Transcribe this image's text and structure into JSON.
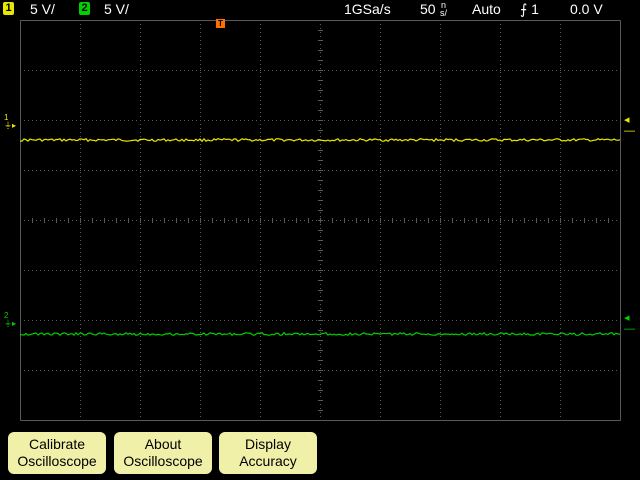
{
  "status": {
    "ch1_number": "1",
    "ch1_scale": "5 V/",
    "ch2_number": "2",
    "ch2_scale": "5 V/",
    "sample_rate": "1GSa/s",
    "timebase_value": "50",
    "timebase_unit_top": "n",
    "timebase_unit_bottom": "s/",
    "trigger_mode": "Auto",
    "trigger_source": "⨍ 1",
    "trigger_level": "0.0 V"
  },
  "markers": {
    "ch1_ground_label": "1",
    "ch2_ground_label": "2",
    "trigger_position_label": "T"
  },
  "softkeys": [
    {
      "line1": "Calibrate",
      "line2": "Oscilloscope"
    },
    {
      "line1": "About",
      "line2": "Oscilloscope"
    },
    {
      "line1": "Display",
      "line2": "Accuracy"
    }
  ],
  "colors": {
    "ch1": "#e8e800",
    "ch2": "#00d000",
    "trigger_marker": "#ff7000",
    "softkey_bg": "#f0f0a8",
    "grid": "#5a5a5a"
  }
}
